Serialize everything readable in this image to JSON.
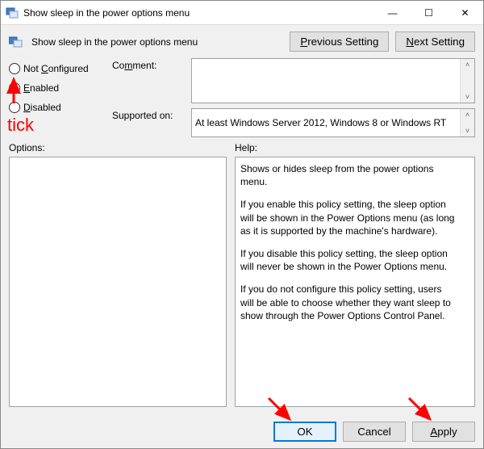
{
  "window": {
    "title": "Show sleep in the power options menu",
    "header_title": "Show sleep in the power options menu"
  },
  "titlebar_buttons": {
    "minimize_glyph": "—",
    "maximize_glyph": "☐",
    "close_glyph": "✕"
  },
  "nav": {
    "previous_label_pre": "",
    "previous_u": "P",
    "previous_label_post": "revious Setting",
    "next_u": "N",
    "next_label_post": "ext Setting"
  },
  "radios": {
    "not_configured_pre": "Not ",
    "not_configured_u": "C",
    "not_configured_post": "onfigured",
    "enabled_u": "E",
    "enabled_post": "nabled",
    "disabled_u": "D",
    "disabled_post": "isabled",
    "selected": "enabled"
  },
  "fields": {
    "comment_u": "m",
    "comment_pre": "Co",
    "comment_post": "ment:",
    "supported_label": "Supported on:",
    "supported_value": "At least Windows Server 2012, Windows 8 or Windows RT"
  },
  "panels": {
    "options_label": "Options:",
    "help_label": "Help:"
  },
  "help_text": {
    "p1": "Shows or hides sleep from the power options menu.",
    "p2": "If you enable this policy setting, the sleep option will be shown in the Power Options menu (as long as it is supported by the machine's hardware).",
    "p3": "If you disable this policy setting, the sleep option will never be shown in the Power Options menu.",
    "p4": "If you do not configure this policy setting, users will be able to choose whether they want sleep to show through the Power Options Control Panel."
  },
  "footer": {
    "ok": "OK",
    "cancel": "Cancel",
    "apply_u": "A",
    "apply_post": "pply"
  },
  "annotations": {
    "tick": "tick"
  },
  "scroll_glyphs": {
    "up": "˄",
    "down": "˅"
  }
}
